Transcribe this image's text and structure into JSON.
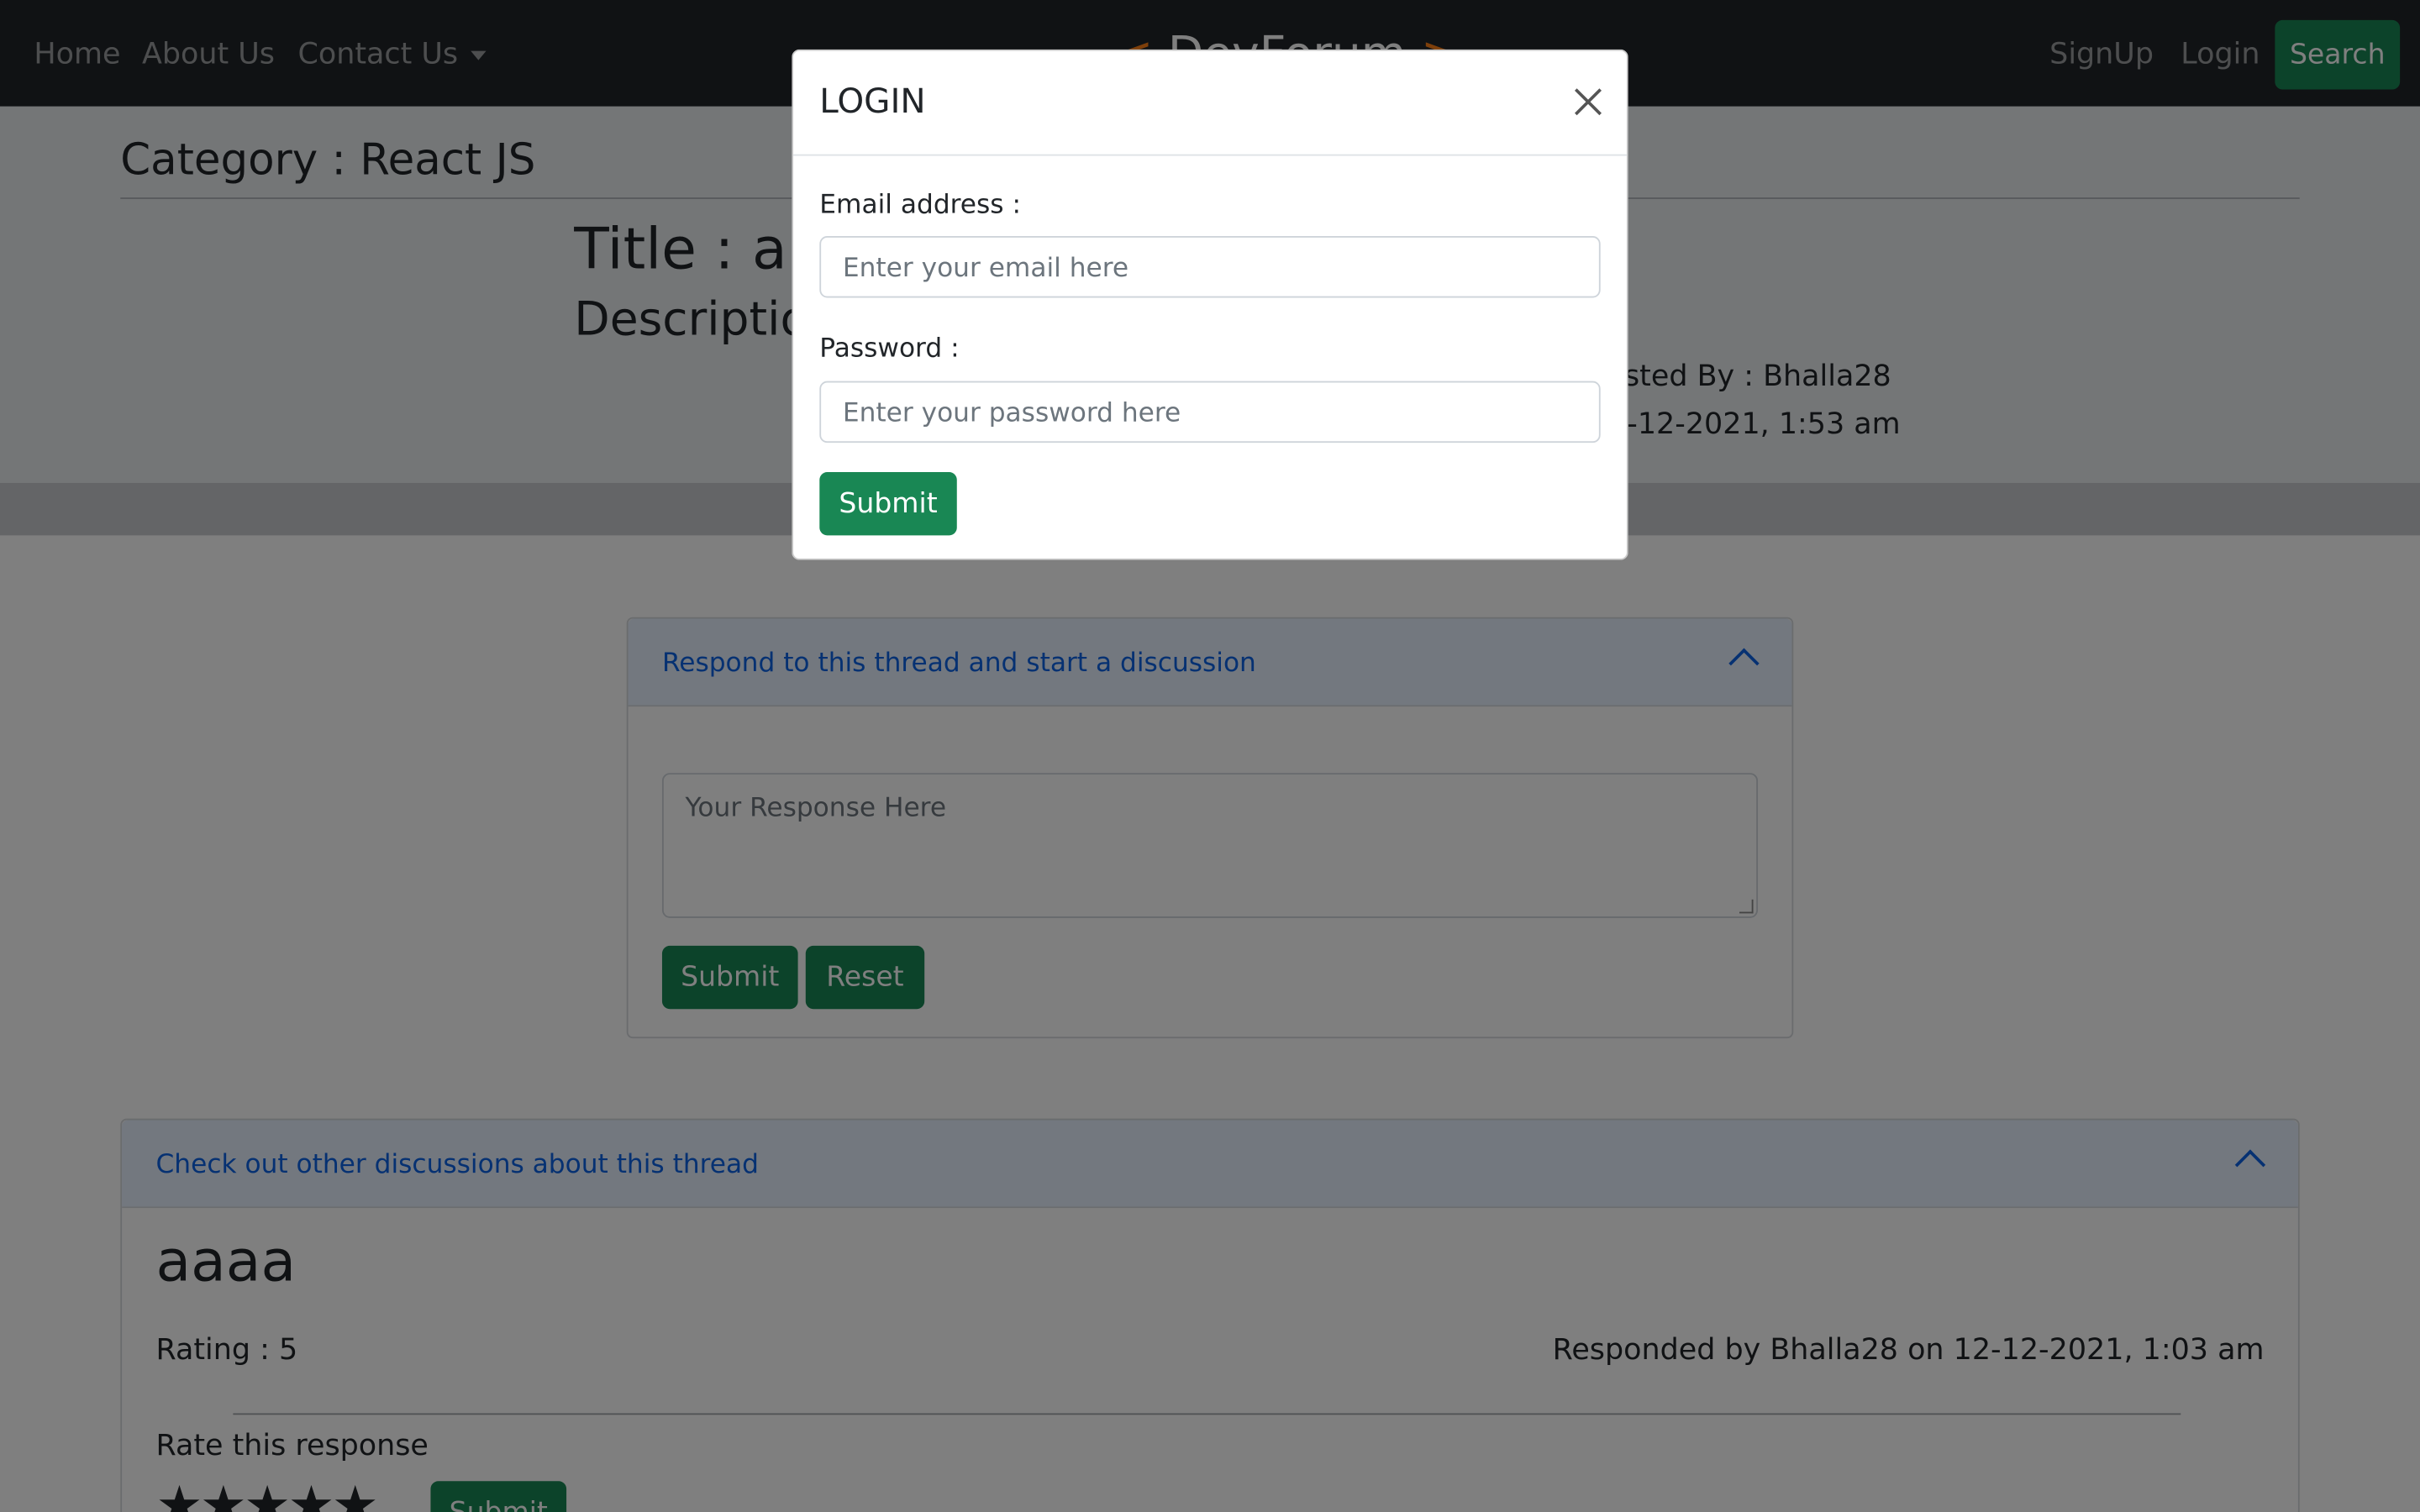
{
  "navbar": {
    "links": [
      "Home",
      "About Us",
      "Contact Us"
    ],
    "brand_left": "<",
    "brand_text": "DevForum",
    "brand_right": ">",
    "signup": "SignUp",
    "login": "Login",
    "search": "Search"
  },
  "category": {
    "title": "Category : React JS"
  },
  "thread": {
    "title": "Title : a",
    "description": "Description : a",
    "posted_by": "Posted By : Bhalla28",
    "posted_on": "12-12-2021, 1:53 am"
  },
  "respond": {
    "header": "Respond to this thread and start a discussion",
    "placeholder": "Your Response Here",
    "submit": "Submit",
    "reset": "Reset"
  },
  "discussions": {
    "header": "Check out other discussions about this thread",
    "items": [
      {
        "title": "aaaa",
        "rating": "Rating : 5",
        "responded_by": "Responded by Bhalla28 on 12-12-2021, 1:03 am",
        "rate_label": "Rate this response",
        "stars": "★★★★★",
        "submit": "Submit"
      }
    ]
  },
  "modal": {
    "title": "LOGIN",
    "email_label": "Email address :",
    "email_placeholder": "Enter your email here",
    "password_label": "Password :",
    "password_placeholder": "Enter your password here",
    "submit": "Submit"
  },
  "colors": {
    "navbar": "#212529",
    "primary_green": "#198754",
    "accordion_header": "#e7f1ff",
    "link_blue": "#0c63e4",
    "brand_accent": "#fd7e14"
  }
}
